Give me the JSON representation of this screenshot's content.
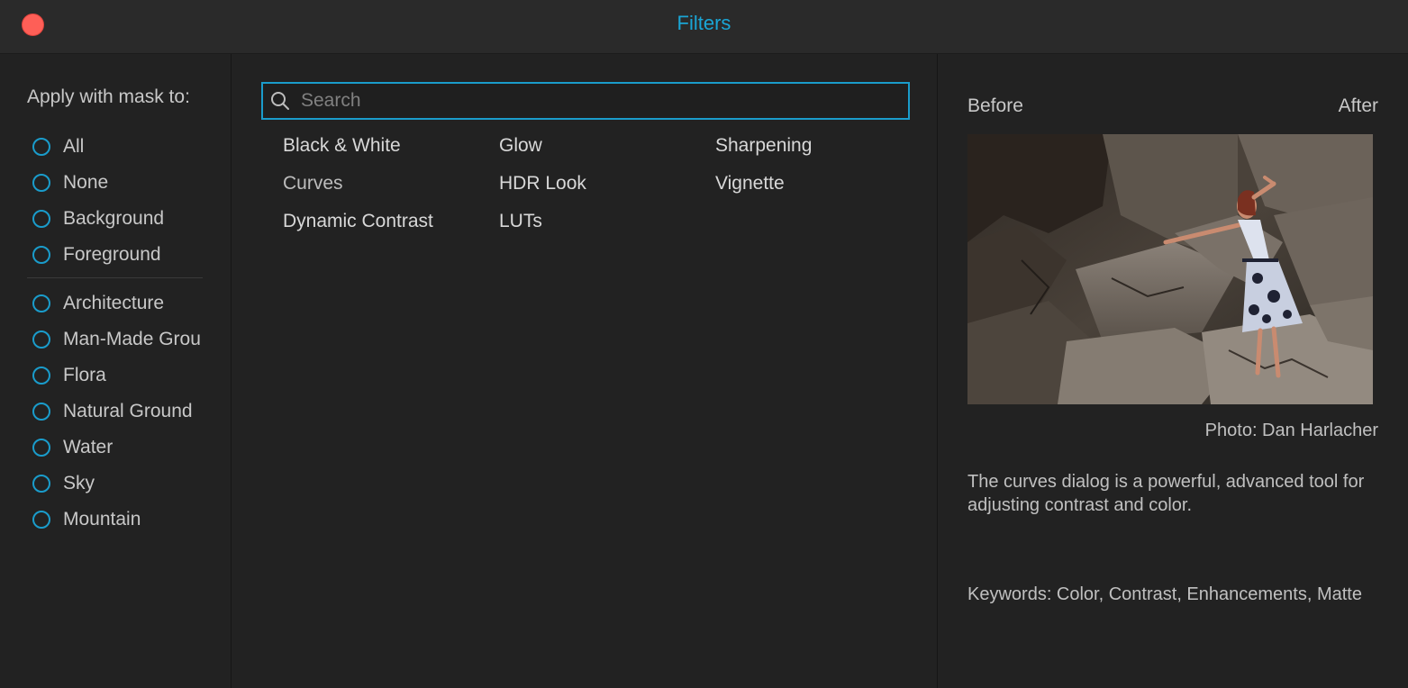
{
  "window": {
    "title": "Filters",
    "accent_color": "#1aa6d6",
    "close_color": "#fe5f57"
  },
  "mask": {
    "heading": "Apply with mask to:",
    "group1": [
      {
        "label": "All"
      },
      {
        "label": "None"
      },
      {
        "label": "Background"
      },
      {
        "label": "Foreground"
      }
    ],
    "group2": [
      {
        "label": "Architecture"
      },
      {
        "label": "Man-Made Grou"
      },
      {
        "label": "Flora"
      },
      {
        "label": "Natural Ground"
      },
      {
        "label": "Water"
      },
      {
        "label": "Sky"
      },
      {
        "label": "Mountain"
      }
    ]
  },
  "search": {
    "placeholder": "Search",
    "value": ""
  },
  "filters": {
    "col1": [
      "Black & White",
      "Curves",
      "Dynamic Contrast"
    ],
    "col2": [
      "Glow",
      "HDR Look",
      "LUTs"
    ],
    "col3": [
      "Sharpening",
      "Vignette"
    ],
    "selected": "Curves"
  },
  "preview": {
    "before_label": "Before",
    "after_label": "After",
    "credit": "Photo: Dan Harlacher",
    "description": "The curves dialog is a powerful, advanced tool for adjusting contrast and color.",
    "keywords": "Keywords: Color, Contrast, Enhancements, Matte"
  }
}
